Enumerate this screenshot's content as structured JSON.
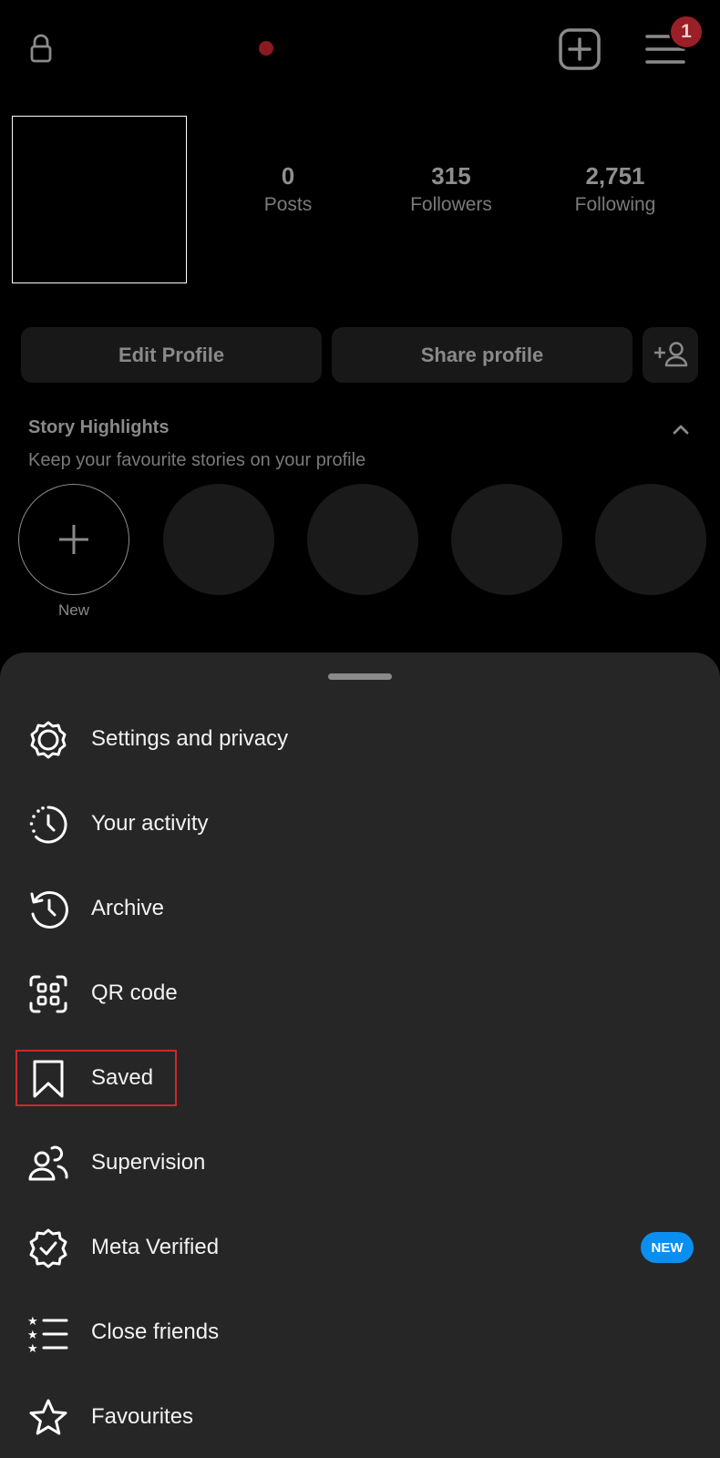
{
  "topbar": {
    "notification_count": "1",
    "icons": [
      "lock-icon",
      "create-icon",
      "menu-icon"
    ]
  },
  "profile": {
    "stats": [
      {
        "value": "0",
        "label": "Posts"
      },
      {
        "value": "315",
        "label": "Followers"
      },
      {
        "value": "2,751",
        "label": "Following"
      }
    ],
    "edit_label": "Edit Profile",
    "share_label": "Share profile"
  },
  "highlights": {
    "title": "Story Highlights",
    "subtitle": "Keep your favourite stories on your profile",
    "new_label": "New"
  },
  "menu": {
    "items": [
      {
        "label": "Settings and privacy",
        "icon": "settings-icon"
      },
      {
        "label": "Your activity",
        "icon": "activity-icon"
      },
      {
        "label": "Archive",
        "icon": "archive-icon"
      },
      {
        "label": "QR code",
        "icon": "qr-code-icon"
      },
      {
        "label": "Saved",
        "icon": "bookmark-icon"
      },
      {
        "label": "Supervision",
        "icon": "supervision-icon"
      },
      {
        "label": "Meta Verified",
        "icon": "verified-icon"
      },
      {
        "label": "Close friends",
        "icon": "close-friends-icon"
      },
      {
        "label": "Favourites",
        "icon": "star-icon"
      }
    ],
    "new_badge": "NEW"
  },
  "colors": {
    "background": "#000000",
    "sheet": "#262626",
    "accent_blue": "#0a8ff0",
    "badge_red": "#9a1f26",
    "highlight_border": "#d3262c"
  }
}
